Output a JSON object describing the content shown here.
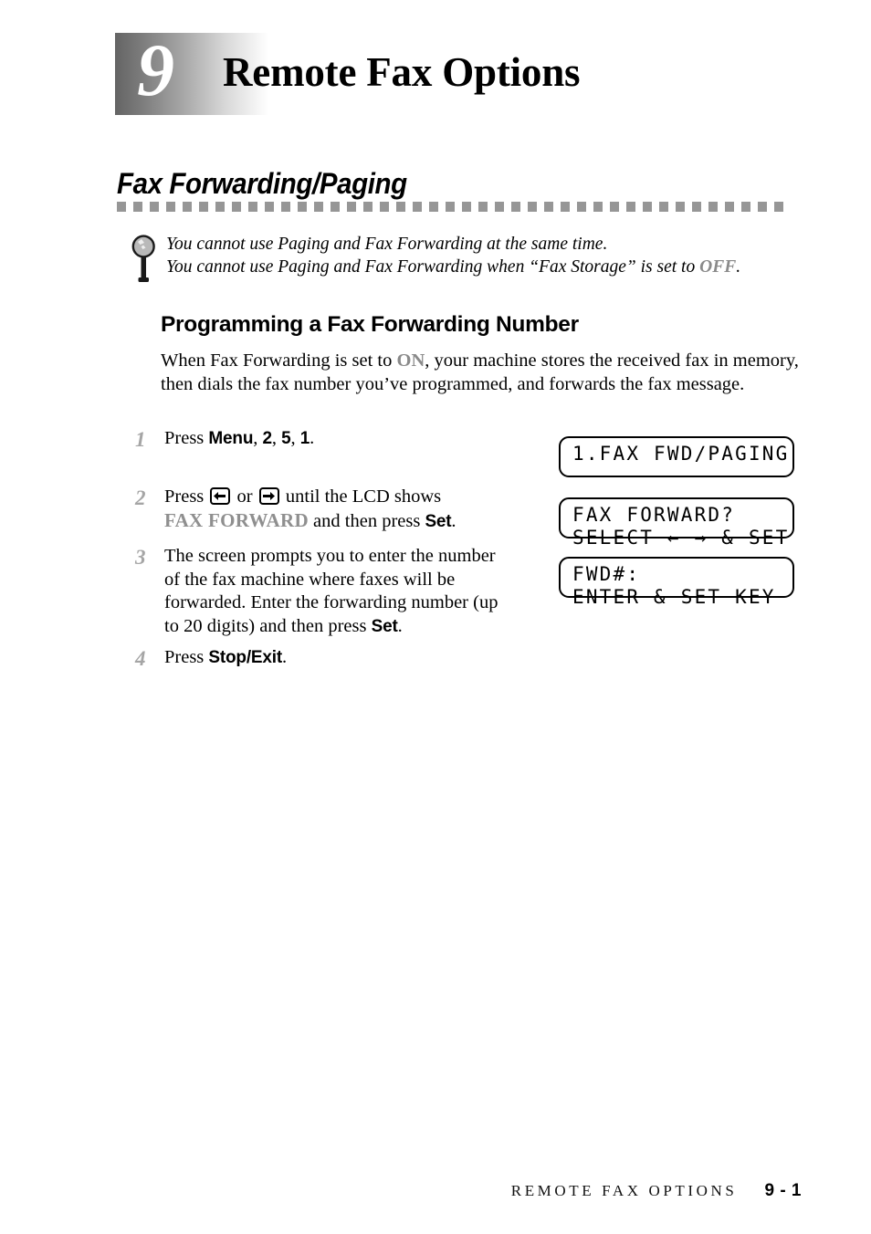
{
  "chapter": {
    "number": "9",
    "title": "Remote Fax Options"
  },
  "section": {
    "title": "Fax Forwarding/Paging"
  },
  "note": {
    "icon": "magnifying-glass-icon",
    "line1": "You cannot use Paging and Fax Forwarding at the same time.",
    "line2_before": "You cannot use Paging and Fax Forwarding when “Fax Storage” is set to",
    "line2_value": "OFF",
    "line2_after": "."
  },
  "subsection": {
    "heading": "Programming a Fax Forwarding Number",
    "intro_before": "When Fax Forwarding is set to",
    "intro_value": "ON",
    "intro_after": ", your machine stores the received fax in memory, then dials the fax number you’ve programmed, and forwards the fax message."
  },
  "steps": [
    {
      "number": "1",
      "text_parts": [
        "Press ",
        "Menu",
        ", ",
        "2",
        ", ",
        "5",
        ", ",
        "1",
        "."
      ]
    },
    {
      "number": "2",
      "line1_before": "Press",
      "left_key": "left-arrow-key",
      "or_label": "or",
      "right_key": "right-arrow-key",
      "line1_after": "until the LCD shows",
      "line2_lcd": "FAX FORWARD",
      "line2_mid": " and then press ",
      "line2_button": "Set",
      "line2_end": "."
    },
    {
      "number": "3",
      "text_before": "The screen prompts you to enter the number of the fax machine where faxes will be forwarded. Enter the forwarding number (up to 20 digits) and then press ",
      "text_button": "Set",
      "text_after": "."
    },
    {
      "number": "4",
      "text_before": "Press ",
      "text_button": "Stop/Exit",
      "text_after": "."
    }
  ],
  "lcd_panels": [
    {
      "line1": "1.FAX FWD∕PAGING",
      "line2": ""
    },
    {
      "line1": "FAX FORWARD?",
      "line2": "SELECT ← → & SET"
    },
    {
      "line1": "FWD#:",
      "line2": "ENTER & SET KEY"
    }
  ],
  "footer": {
    "text": "REMOTE FAX OPTIONS",
    "page": "9 - 1"
  },
  "colors": {
    "gray_accent": "#8a8a8a",
    "step_number": "#a5a5a5",
    "rule": "#969696"
  }
}
